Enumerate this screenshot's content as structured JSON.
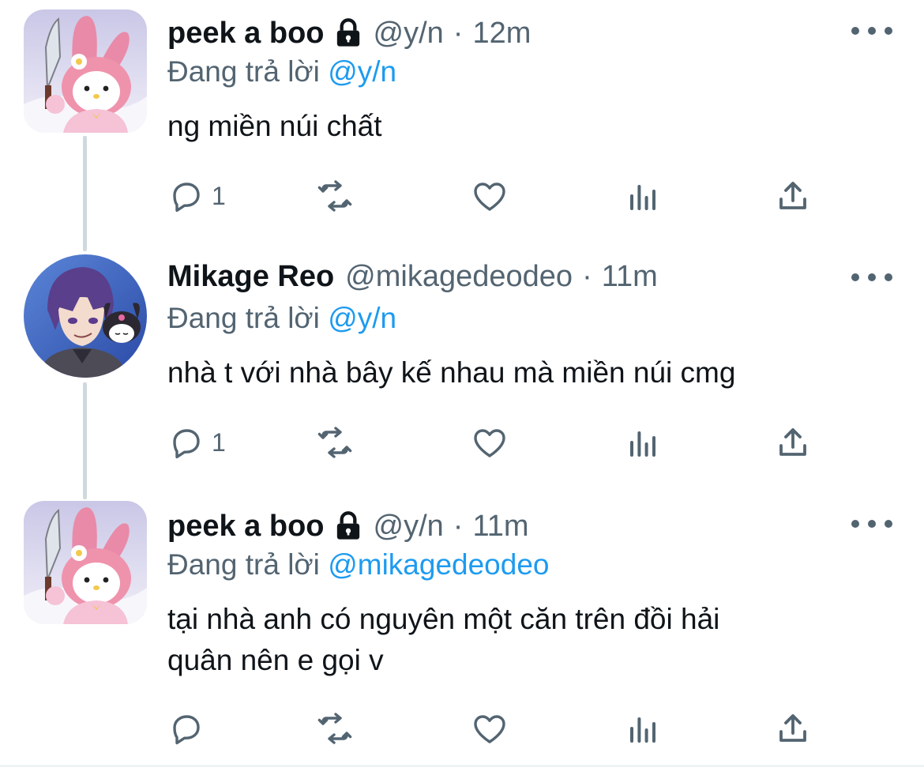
{
  "colors": {
    "text": "#0f1419",
    "secondary": "#536471",
    "mention": "#1d9bf0",
    "thread_line": "#cfd9de"
  },
  "tweets": [
    {
      "name": "peek a boo",
      "locked": true,
      "handle": "@y/n",
      "time": "12m",
      "reply_prefix": "Đang trả lời",
      "reply_to": "@y/n",
      "lines": [
        "ng miền núi chất"
      ],
      "reply_count": "1",
      "avatar": "my-melody-avatar"
    },
    {
      "name": "Mikage Reo",
      "locked": false,
      "handle": "@mikagedeodeo",
      "time": "11m",
      "reply_prefix": "Đang trả lời",
      "reply_to": "@y/n",
      "lines": [
        "nhà t với nhà bây kế nhau mà miền núi cmg"
      ],
      "reply_count": "1",
      "avatar": "anime-character-avatar"
    },
    {
      "name": "peek a boo",
      "locked": true,
      "handle": "@y/n",
      "time": "11m",
      "reply_prefix": "Đang trả lời",
      "reply_to": "@mikagedeodeo",
      "lines": [
        "tại nhà anh có nguyên một căn trên đồi hải",
        "quân nên e gọi v"
      ],
      "reply_count": "",
      "avatar": "my-melody-avatar"
    }
  ],
  "separator": "·",
  "icons": [
    "reply-icon",
    "retweet-icon",
    "like-icon",
    "analytics-icon",
    "share-icon",
    "more-icon",
    "lock-icon"
  ]
}
